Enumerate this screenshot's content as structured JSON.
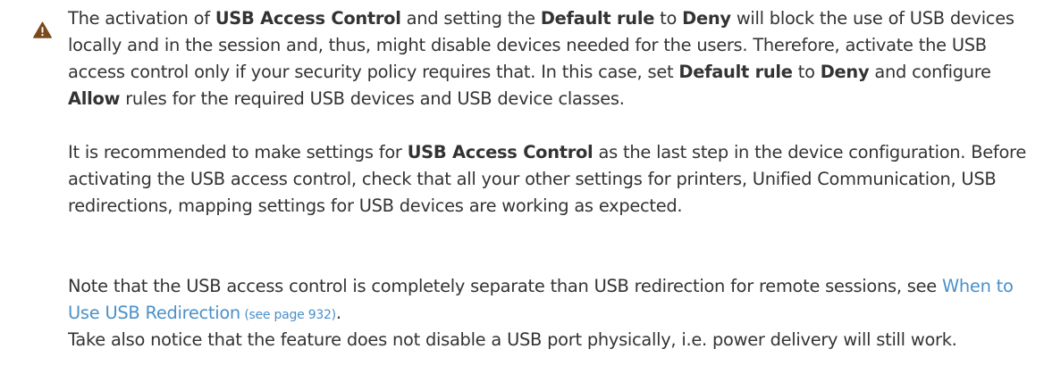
{
  "warning": {
    "icon": "warning-triangle-icon",
    "icon_color": "#7a4a1a",
    "link_color": "#4a90c9",
    "paragraphs": [
      {
        "segments": [
          {
            "text": "The activation of ",
            "bold": false
          },
          {
            "text": "USB Access Control",
            "bold": true
          },
          {
            "text": " and setting the ",
            "bold": false
          },
          {
            "text": "Default rule",
            "bold": true
          },
          {
            "text": " to ",
            "bold": false
          },
          {
            "text": "Deny",
            "bold": true
          },
          {
            "text": " will block the use of USB devices locally and in the session and, thus, might disable devices needed for the users. Therefore, activate the USB access control only if your security policy requires that. In this case, set ",
            "bold": false
          },
          {
            "text": "Default rule",
            "bold": true
          },
          {
            "text": " to ",
            "bold": false
          },
          {
            "text": "Deny",
            "bold": true
          },
          {
            "text": " and configure ",
            "bold": false
          },
          {
            "text": "Allow",
            "bold": true
          },
          {
            "text": " rules for the required USB devices and USB device classes.",
            "bold": false
          }
        ]
      },
      {
        "segments": [
          {
            "text": "It is recommended to make settings for ",
            "bold": false
          },
          {
            "text": "USB Access Control",
            "bold": true
          },
          {
            "text": " as the last step in the device configuration. Before activating the USB access control, check that all your other settings for printers, Unified Communication, USB redirections, mapping settings for USB devices are working as expected.",
            "bold": false
          }
        ]
      },
      {
        "segments": [
          {
            "text": "Note that the USB access control is completely separate than USB redirection for remote sessions, see ",
            "bold": false
          }
        ],
        "link_text": "When to Use USB Redirection",
        "page_ref": " (see page 932)",
        "trailing": "."
      },
      {
        "segments": [
          {
            "text": "Take also notice that the feature does not disable a USB port physically, i.e. power delivery will still work.",
            "bold": false
          }
        ]
      }
    ]
  }
}
